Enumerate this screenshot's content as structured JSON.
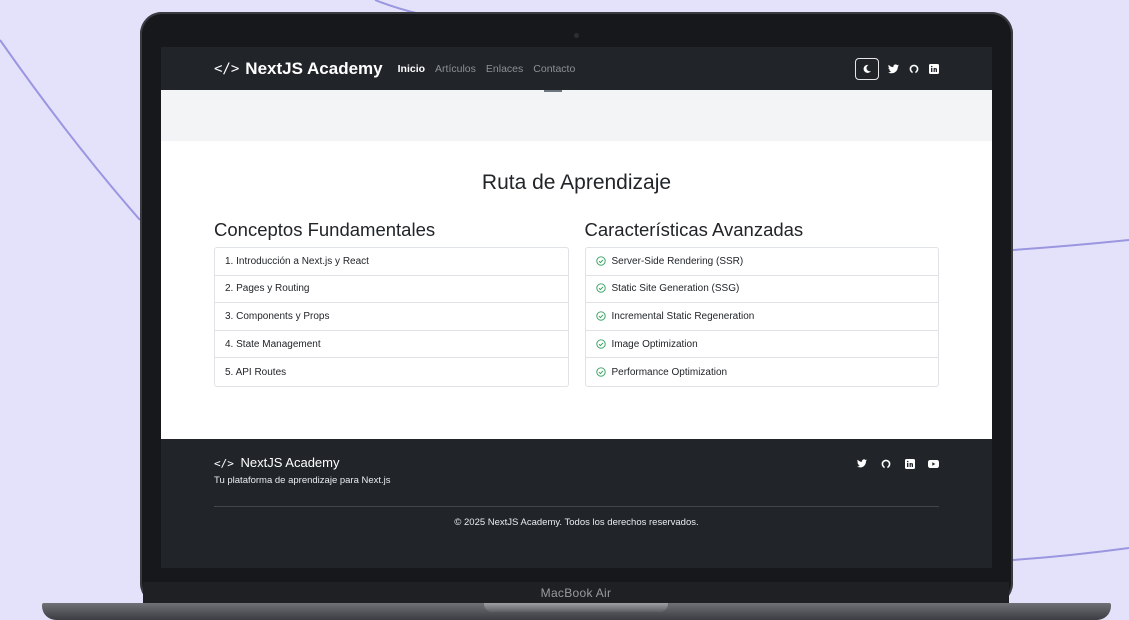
{
  "device": {
    "label": "MacBook Air"
  },
  "navbar": {
    "brand_icon": "</>",
    "brand_text": "NextJS Academy",
    "links": [
      {
        "label": "Inicio",
        "active": true
      },
      {
        "label": "Artículos",
        "active": false
      },
      {
        "label": "Enlaces",
        "active": false
      },
      {
        "label": "Contacto",
        "active": false
      }
    ],
    "theme_toggle_icon": "moon-icon",
    "social_icons": [
      "twitter-icon",
      "github-icon",
      "linkedin-icon"
    ]
  },
  "main": {
    "title": "Ruta de Aprendizaje",
    "fundamentals": {
      "title": "Conceptos Fundamentales",
      "items": [
        "1. Introducción a Next.js y React",
        "2. Pages y Routing",
        "3. Components y Props",
        "4. State Management",
        "5. API Routes"
      ]
    },
    "advanced": {
      "title": "Características Avanzadas",
      "item_icon": "check-circle-icon",
      "items": [
        "Server-Side Rendering (SSR)",
        "Static Site Generation (SSG)",
        "Incremental Static Regeneration",
        "Image Optimization",
        "Performance Optimization"
      ]
    }
  },
  "footer": {
    "brand_icon": "</>",
    "brand_text": "NextJS Academy",
    "tagline": "Tu plataforma de aprendizaje para Next.js",
    "social_icons": [
      "twitter-icon",
      "github-icon",
      "linkedin-icon",
      "youtube-icon"
    ],
    "copyright": "© 2025 NextJS Academy. Todos los derechos reservados."
  },
  "colors": {
    "background": "#e4e2fb",
    "navbar": "#212529",
    "check": "#2e9e5b",
    "curve": "#9a96e0"
  }
}
